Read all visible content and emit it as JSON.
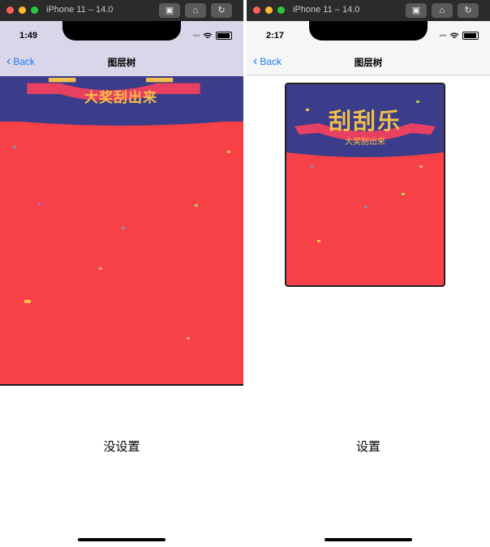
{
  "left": {
    "window_title": "iPhone 11 – 14.0",
    "time": "1:49",
    "back_label": "Back",
    "nav_title": "图层树",
    "banner_subtitle": "大奖刮出来",
    "caption": "没设置"
  },
  "right": {
    "window_title": "iPhone 11 – 14.0",
    "time": "2:17",
    "back_label": "Back",
    "nav_title": "图层树",
    "banner_title": "刮刮乐",
    "banner_subtitle": "大奖刮出来",
    "caption": "设置"
  },
  "colors": {
    "scratch_red": "#f84047",
    "banner_purple": "#3c3d8a",
    "accent_blue": "#1a7cf5"
  },
  "icons": [
    "screenshot-icon",
    "home-icon",
    "rotate-icon",
    "wifi-icon",
    "battery-icon",
    "back-chevron-icon"
  ]
}
